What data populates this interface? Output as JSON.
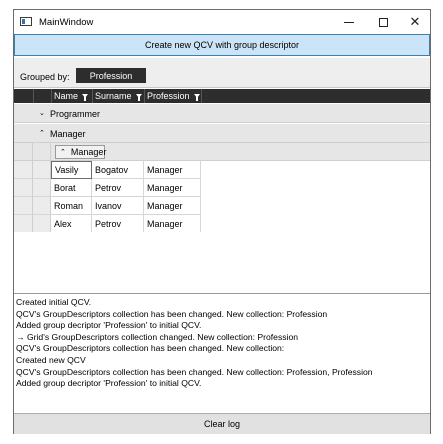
{
  "window": {
    "title": "MainWindow",
    "minimize_glyph": "minimize",
    "maximize_glyph": "maximize",
    "close_glyph": "✕"
  },
  "toolbar": {
    "create_label": "Create new QCV with group descriptor"
  },
  "grouping": {
    "label": "Grouped by:",
    "chip": "Profession"
  },
  "grid": {
    "columns": [
      "Name",
      "Surname",
      "Profession"
    ],
    "groups": [
      {
        "label": "Programmer",
        "expanded": false
      },
      {
        "label": "Manager",
        "expanded": true
      }
    ],
    "subgroup": {
      "label": "Manager",
      "expanded": true
    },
    "rows": [
      {
        "name": "Vasily",
        "surname": "Bogatov",
        "profession": "Manager"
      },
      {
        "name": "Borat",
        "surname": "Petrov",
        "profession": "Manager"
      },
      {
        "name": "Roman",
        "surname": "Ivanov",
        "profession": "Manager"
      },
      {
        "name": "Alex",
        "surname": "Petrov",
        "profession": "Manager"
      }
    ]
  },
  "log": {
    "lines": [
      "Created initial QCV.",
      "QCV's GroupDescriptors collection has been changed. New collection: Profession",
      "Added group decriptor 'Profession' to initial QCV.",
      "→ Grid's GroupDescriptors collection changed. New collection: Profession",
      "QCV's GroupDescriptors collection has been changed. New collection:",
      "Created new QCV",
      "QCV's GroupDescriptors collection has been changed. New collection: Profession, Profession",
      "Added group decriptor 'Profession' to initial QCV."
    ]
  },
  "footer": {
    "clear_label": "Clear log"
  }
}
